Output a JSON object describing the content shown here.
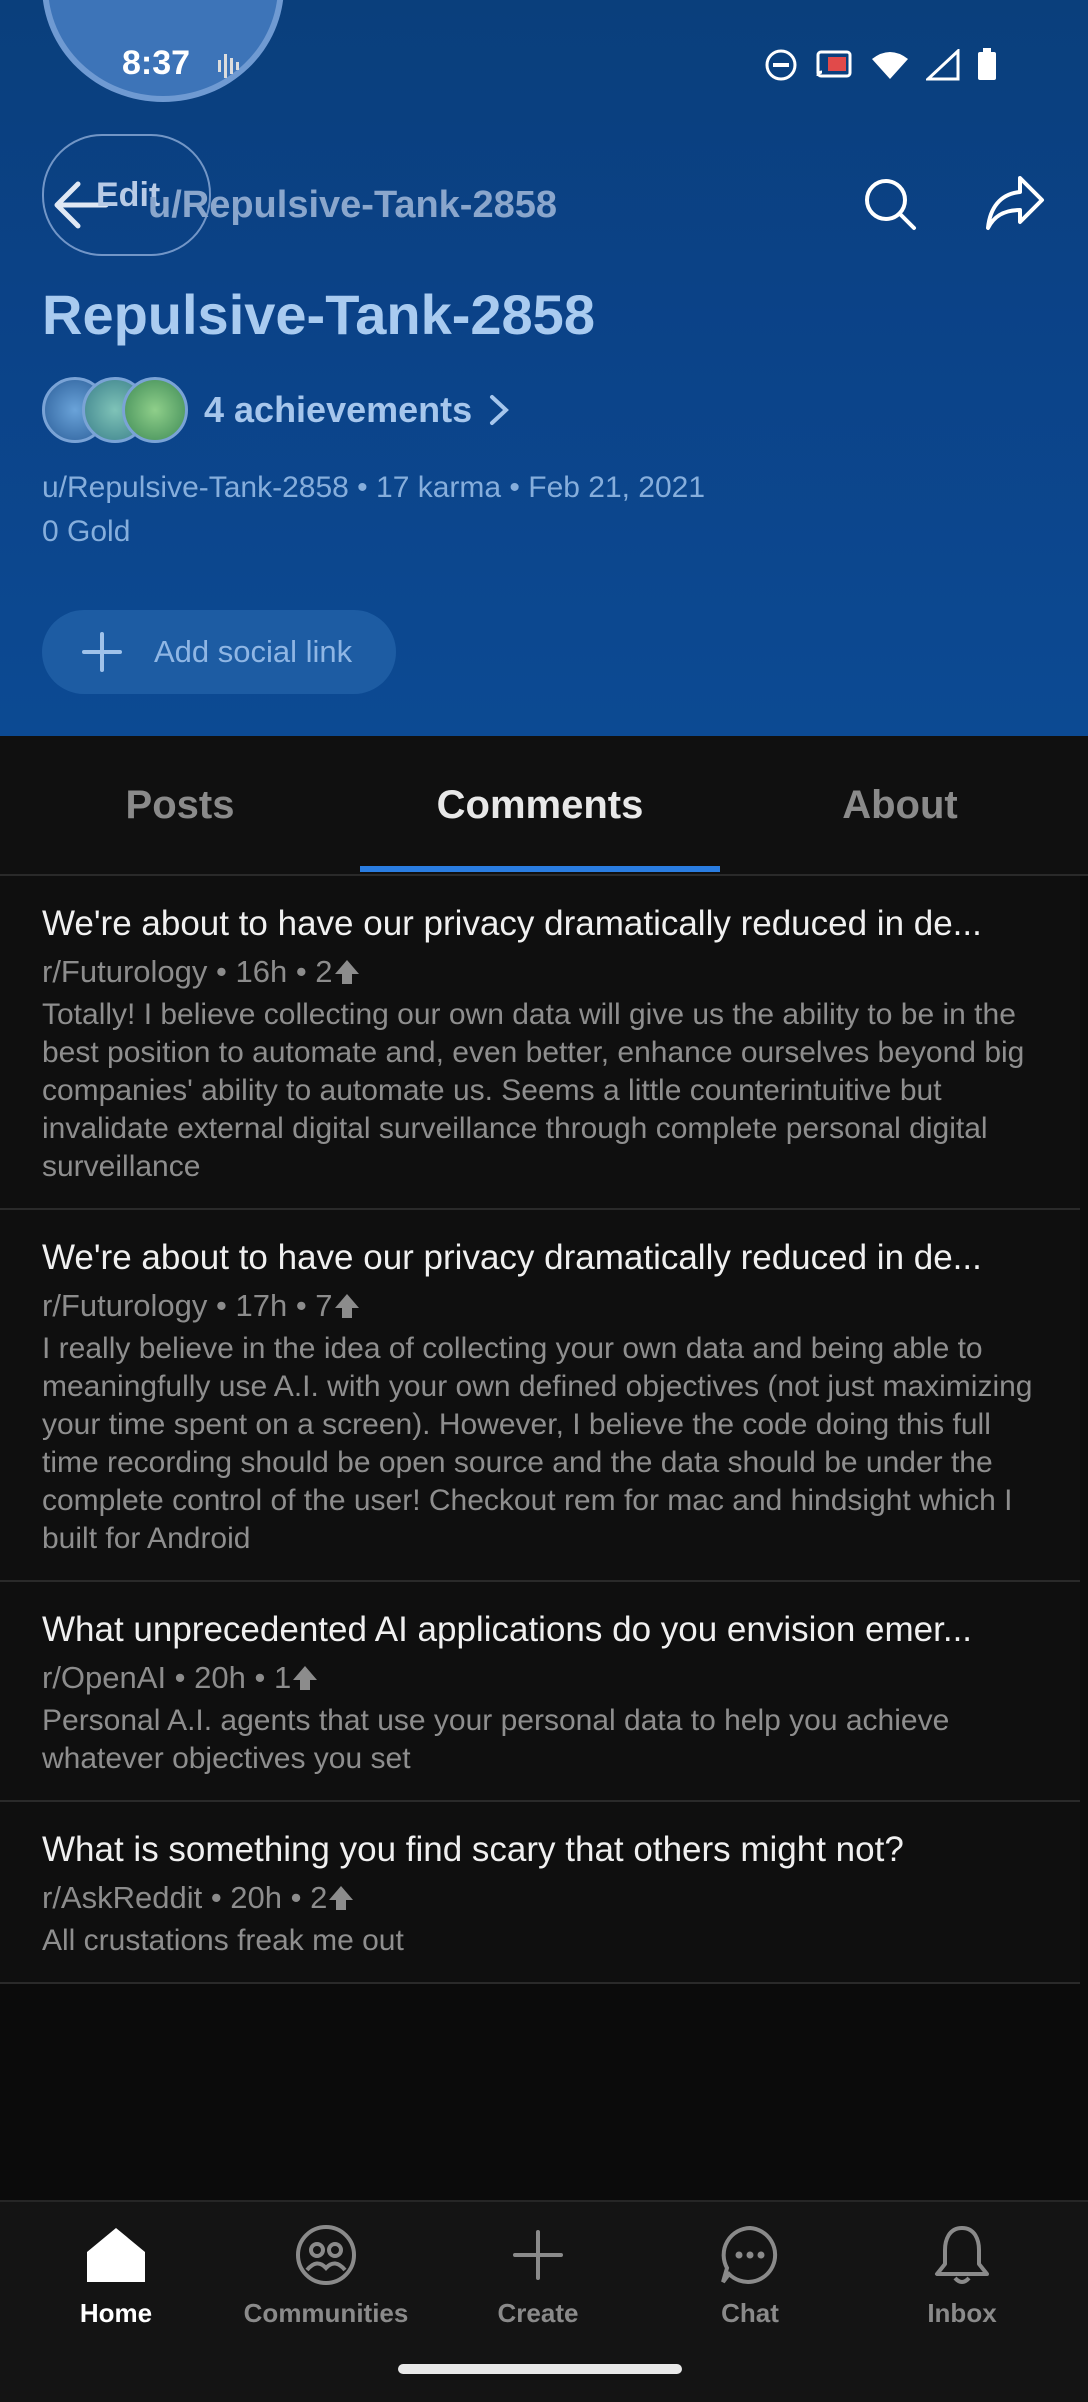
{
  "status_bar": {
    "time": "8:37"
  },
  "top_nav": {
    "edit_label": "Edit",
    "title": "u/Repulsive-Tank-2858"
  },
  "profile": {
    "username": "Repulsive-Tank-2858",
    "achievements_label": "4 achievements",
    "meta_line1": "u/Repulsive-Tank-2858 • 17 karma • Feb 21, 2021",
    "meta_line2": "0 Gold",
    "social_button_label": "Add social link"
  },
  "tabs": [
    {
      "label": "Posts"
    },
    {
      "label": "Comments",
      "active": true
    },
    {
      "label": "About"
    }
  ],
  "comments": [
    {
      "title": "We're about to have our privacy dramatically reduced in de...",
      "meta": "r/Futurology • 16h • 2",
      "body": "Totally! I believe collecting our own data will give us the ability to be in the best position to automate and, even better, enhance ourselves beyond big companies' ability to automate us. Seems a little counterintuitive but invalidate external digital surveillance through complete personal digital surveillance"
    },
    {
      "title": "We're about to have our privacy dramatically reduced in de...",
      "meta": "r/Futurology • 17h • 7",
      "body": "I really believe in the idea of collecting your own data and being able to meaningfully use A.I. with your own defined objectives (not just maximizing your time spent on a screen). However, I believe the code doing this full time recording should be open source and the data should be under the complete control of the user!  Checkout rem for mac and hindsight which I built for Android"
    },
    {
      "title": "What unprecedented AI applications do you envision emer...",
      "meta": "r/OpenAI • 20h • 1",
      "body": "Personal A.I. agents that use your personal data to help you achieve whatever objectives you set"
    },
    {
      "title": "What is something you find scary that others might not?",
      "meta": "r/AskReddit • 20h • 2",
      "body": "All crustations freak me out"
    }
  ],
  "bottom_nav": [
    {
      "label": "Home",
      "icon": "home-icon",
      "active": true
    },
    {
      "label": "Communities",
      "icon": "communities-icon"
    },
    {
      "label": "Create",
      "icon": "plus-icon"
    },
    {
      "label": "Chat",
      "icon": "chat-icon"
    },
    {
      "label": "Inbox",
      "icon": "bell-icon"
    }
  ],
  "colors": {
    "accent": "#2a7de1",
    "header_bg": "#0b4287",
    "background": "#0b0b0b"
  }
}
